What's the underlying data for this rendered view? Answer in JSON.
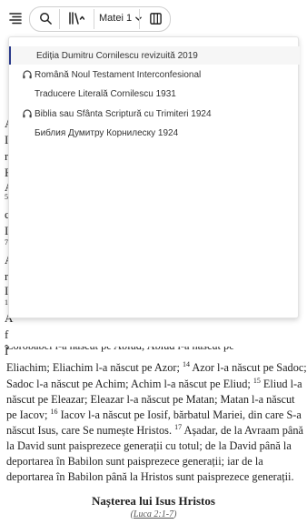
{
  "toolbar": {
    "chapter_label": "Matei 1"
  },
  "versions": [
    {
      "label": "Ediția Dumitru Cornilescu revizuită 2019",
      "audio": false,
      "active": true
    },
    {
      "label": "Română Noul Testament Interconfesional",
      "audio": true,
      "active": false
    },
    {
      "label": "Traducere Literală Cornilescu 1931",
      "audio": false,
      "active": false
    },
    {
      "label": "Biblia sau Sfânta Scriptură cu Trimiteri 1924",
      "audio": true,
      "active": false
    },
    {
      "label": "Библия Думитру Корнилеску 1924",
      "audio": false,
      "active": false
    }
  ],
  "background_letters": [
    "A",
    "I",
    "r",
    "F",
    "A",
    "5",
    "c",
    "I",
    "7",
    "A",
    "r",
    "I",
    "1",
    "A",
    "f",
    "Î"
  ],
  "passage": {
    "partial_top": "Zorobabel l-a născut pe Abiud; Abiud l-a născut pe",
    "line1": "Eliachim; Eliachim l-a născut pe Azor;",
    "v14": "14",
    "line1b": "Azor l-a născut pe Sadoc;",
    "line2": "Sadoc l-a născut pe Achim; Achim l-a născut pe Eliud;",
    "v15": "15",
    "line2b": "Eliud l-a",
    "line3": "născut pe Eleazar; Eleazar l-a născut pe Matan; Matan l-a născut",
    "line4": "pe Iacov;",
    "v16": "16",
    "line4b": "Iacov l-a născut pe Iosif, bărbatul Mariei, din care S-a",
    "line5": "născut Isus, care Se numește Hristos.",
    "v17": "17",
    "line5b": "Așadar, de la Avraam până",
    "line6": "la David sunt paisprezece generații cu totul; de la David până la",
    "line7": "deportarea în Babilon sunt paisprezece generații; iar de la",
    "line8": "deportarea în Babilon până la Hristos sunt paisprezece generații."
  },
  "section": {
    "heading": "Nașterea lui Isus Hristos",
    "ref_open": "(",
    "ref_link": "Luca 2:1-7",
    "ref_close": ")"
  }
}
